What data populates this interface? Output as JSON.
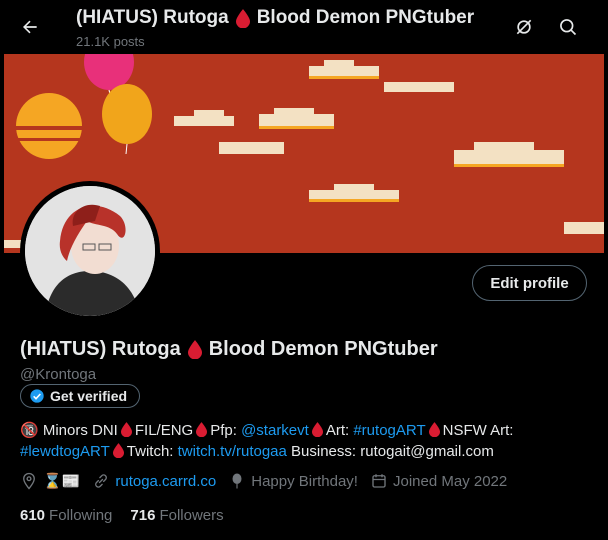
{
  "header": {
    "title_prefix": "(HIATUS) Rutoga",
    "title_suffix": "Blood Demon PNGtuber",
    "posts_count": "21.1K posts"
  },
  "profile": {
    "edit_label": "Edit profile",
    "name_prefix": "(HIATUS) Rutoga",
    "name_suffix": "Blood Demon PNGtuber",
    "handle": "@Krontoga",
    "verify_label": "Get verified"
  },
  "bio": {
    "p1": "🔞 Minors DNI",
    "p2": "FIL/ENG",
    "p3": "Pfp:",
    "pfp_link": "@starkevt",
    "p4": "Art:",
    "art_link": "#rutogART",
    "p5": "NSFW Art:",
    "nsfw_link": "#lewdtogART",
    "p6": "Twitch:",
    "twitch_link": "twitch.tv/rutogaa",
    "p7": "Business: rutogait@gmail.com"
  },
  "meta": {
    "location": "⌛📰",
    "website": "rutoga.carrd.co",
    "birthday": "Happy Birthday!",
    "joined": "Joined May 2022"
  },
  "stats": {
    "following_count": "610",
    "following_label": "Following",
    "followers_count": "716",
    "followers_label": "Followers"
  },
  "colors": {
    "accent": "#1d9bf0",
    "banner": "#b5361e",
    "blood_drop": "#d91c32",
    "muted": "#71767b"
  },
  "icons": [
    "back-arrow-icon",
    "blood-drop-icon",
    "hide-icon",
    "search-icon",
    "verified-badge-icon",
    "location-icon",
    "link-icon",
    "balloon-icon",
    "calendar-icon"
  ]
}
